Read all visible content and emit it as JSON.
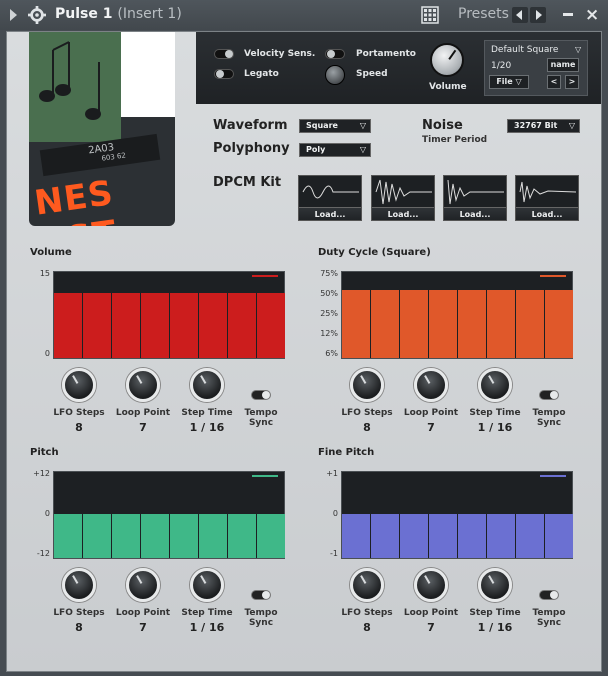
{
  "window": {
    "title": "Pulse 1",
    "insert": "(Insert 1)",
    "presets_label": "Presets"
  },
  "logo": {
    "text": "NES VST",
    "chip_line1": "2A03",
    "chip_line2": "603 62"
  },
  "top": {
    "velocity_sens": "Velocity Sens.",
    "legato": "Legato",
    "portamento": "Portamento",
    "speed": "Speed",
    "volume": "Volume",
    "preset_name": "Default Square",
    "preset_index": "1/20",
    "name_btn": "name",
    "file_btn": "File",
    "prev_btn": "<",
    "next_btn": ">"
  },
  "settings": {
    "waveform_label": "Waveform",
    "waveform_value": "Square",
    "polyphony_label": "Polyphony",
    "polyphony_value": "Poly",
    "noise_label": "Noise",
    "noise_sub": "Timer Period",
    "noise_value": "32767 Bit",
    "dpcm_label": "DPCM Kit",
    "load_label": "Load..."
  },
  "sections": [
    {
      "title": "Volume",
      "ticks": [
        "15",
        "0"
      ],
      "color": "#cc1d1d",
      "level": 0.74
    },
    {
      "title": "Duty Cycle (Square)",
      "ticks": [
        "75%",
        "50%",
        "25%",
        "12%",
        "6%"
      ],
      "color": "#e0582a",
      "level": 0.77
    },
    {
      "title": "Pitch",
      "ticks": [
        "+12",
        "0",
        "-12"
      ],
      "color": "#3fb888",
      "level": 0.5
    },
    {
      "title": "Fine Pitch",
      "ticks": [
        "+1",
        "0",
        "-1"
      ],
      "color": "#6b70d2",
      "level": 0.5
    }
  ],
  "knobs": {
    "lfo_label": "LFO Steps",
    "loop_label": "Loop Point",
    "step_label": "Step Time",
    "tempo_label_1": "Tempo",
    "tempo_label_2": "Sync",
    "lfo_value": "8",
    "loop_value": "7",
    "step_value": "1 / 16"
  }
}
